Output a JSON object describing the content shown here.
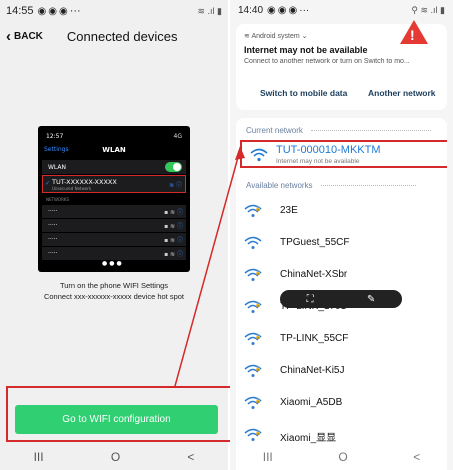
{
  "left": {
    "status": {
      "time": "14:55",
      "extra": "···"
    },
    "header": {
      "back": "BACK",
      "title": "Connected devices"
    },
    "screenshot": {
      "time": "12:57",
      "signal": "4G",
      "back": "Settings",
      "title": "WLAN",
      "wlan_label": "WLAN",
      "current": {
        "name": "TUT-XXXXXX-XXXXX",
        "status": "Unsecured Network"
      },
      "section": "NETWORKS",
      "networks": [
        "·····",
        "·····",
        "·····",
        "·····"
      ]
    },
    "instruction_line1": "Turn on the phone WIFI Settings",
    "instruction_line2": "Connect xxx-xxxxxx-xxxxx device hot spot",
    "button": "Go to WIFI configuration",
    "nav": {
      "recent": "III",
      "home": "O",
      "back": "<"
    }
  },
  "right": {
    "status": {
      "time": "14:40",
      "extra": "···"
    },
    "notification": {
      "source": "Android system",
      "title": "Internet may not be available",
      "body": "Connect to another network or turn on Switch to mo...",
      "action1": "Switch to mobile data",
      "action2": "Another network"
    },
    "current_label": "Current network",
    "current": {
      "name": "TUT-000010-MKKTM",
      "status": "Internet may not be available"
    },
    "available_label": "Available networks",
    "networks": [
      {
        "name": "23E",
        "locked": true
      },
      {
        "name": "TPGuest_55CF",
        "locked": false
      },
      {
        "name": "ChinaNet-XSbr",
        "locked": true
      },
      {
        "name": "TP-LINK_1701",
        "locked": true
      },
      {
        "name": "TP-LINK_55CF",
        "locked": true
      },
      {
        "name": "ChinaNet-Ki5J",
        "locked": true
      },
      {
        "name": "Xiaomi_A5DB",
        "locked": true
      },
      {
        "name": "Xiaomi_显显",
        "locked": true
      }
    ],
    "nav": {
      "recent": "III",
      "home": "O",
      "back": "<"
    }
  },
  "colors": {
    "accent_green": "#2fcf72",
    "highlight_red": "#d42a2a",
    "link_blue": "#1f7ad6"
  }
}
